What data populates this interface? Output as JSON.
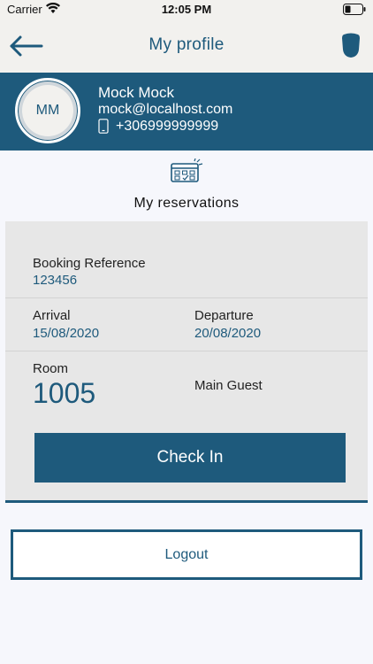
{
  "status_bar": {
    "carrier": "Carrier",
    "time": "12:05 PM"
  },
  "nav": {
    "title": "My profile",
    "back_icon": "arrow-left-icon",
    "right_icon": "shield-icon"
  },
  "profile": {
    "initials": "MM",
    "name": "Mock Mock",
    "email": "mock@localhost.com",
    "phone": "+306999999999"
  },
  "reservations": {
    "icon": "calendar-icon",
    "title": "My reservations",
    "booking_reference_label": "Booking Reference",
    "booking_reference": "123456",
    "arrival_label": "Arrival",
    "arrival": "15/08/2020",
    "departure_label": "Departure",
    "departure": "20/08/2020",
    "room_label": "Room",
    "room": "1005",
    "main_guest_label": "Main Guest",
    "check_in_label": "Check In"
  },
  "logout_label": "Logout",
  "colors": {
    "primary": "#1e5a7c",
    "header_bg": "#f2f1ee",
    "card_bg": "#e7e7e7",
    "page_bg": "#f6f7fc"
  }
}
